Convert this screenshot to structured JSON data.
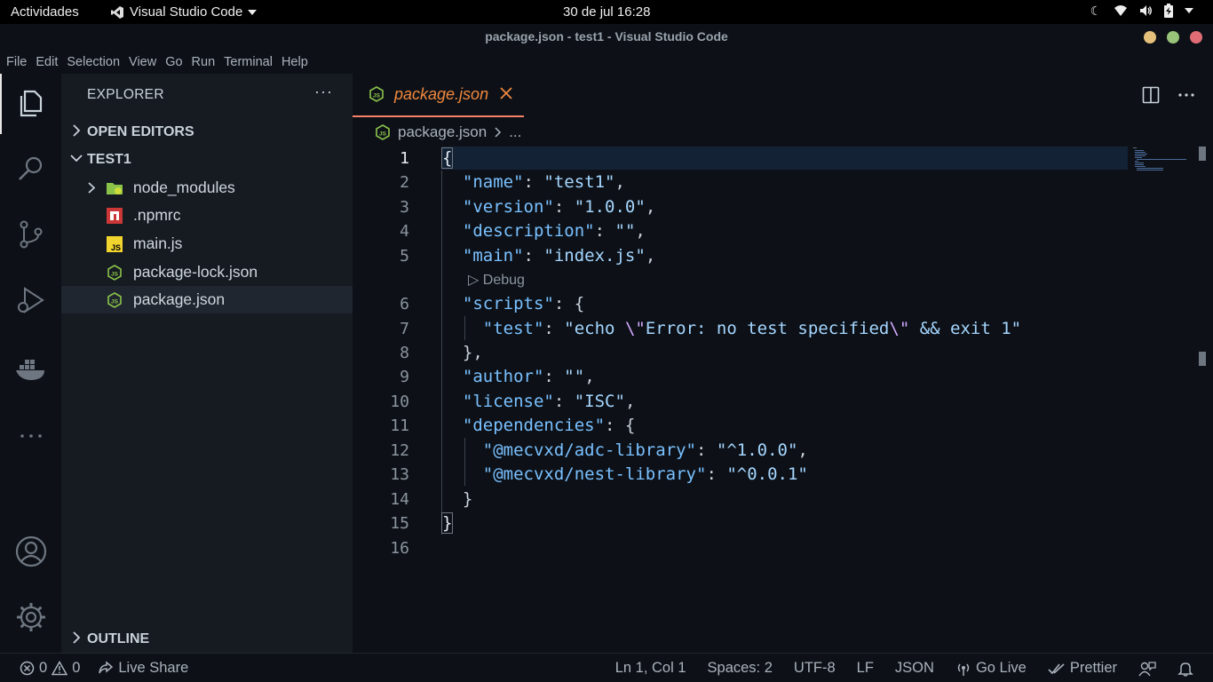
{
  "topbar": {
    "activities": "Actividades",
    "app_name": "Visual Studio Code",
    "clock": "30 de jul  16:28"
  },
  "window": {
    "title": "package.json - test1 - Visual Studio Code",
    "buttons": {
      "minimize_color": "#e5c07b",
      "maximize_color": "#98c379",
      "close_color": "#e06c75"
    }
  },
  "menu": [
    "File",
    "Edit",
    "Selection",
    "View",
    "Go",
    "Run",
    "Terminal",
    "Help"
  ],
  "activity_bar": [
    "explorer-icon",
    "search-icon",
    "source-control-icon",
    "run-debug-icon",
    "docker-icon",
    "more-icon",
    "account-icon",
    "settings-gear-icon"
  ],
  "sidebar": {
    "title": "EXPLORER",
    "more": "···",
    "open_editors": "OPEN EDITORS",
    "folder": "TEST1",
    "items": [
      {
        "label": "node_modules",
        "icon": "folder-node-icon"
      },
      {
        "label": ".npmrc",
        "icon": "npm-icon"
      },
      {
        "label": "main.js",
        "icon": "js-icon"
      },
      {
        "label": "package-lock.json",
        "icon": "nodejs-icon"
      },
      {
        "label": "package.json",
        "icon": "nodejs-icon"
      }
    ],
    "outline": "OUTLINE"
  },
  "editor": {
    "tab_label": "package.json",
    "breadcrumb_file": "package.json",
    "breadcrumb_more": "...",
    "codelens": "Debug",
    "line_numbers": [
      "1",
      "2",
      "3",
      "4",
      "5",
      "6",
      "7",
      "8",
      "9",
      "10",
      "11",
      "12",
      "13",
      "14",
      "15",
      "16"
    ]
  },
  "status": {
    "errors": "0",
    "warnings": "0",
    "live_share": "Live Share",
    "position": "Ln 1, Col 1",
    "spaces": "Spaces: 2",
    "encoding": "UTF-8",
    "eol": "LF",
    "language": "JSON",
    "go_live": "Go Live",
    "prettier": "Prettier"
  },
  "colors": {
    "accent": "#f78166",
    "tab_text": "#f0883e",
    "json_key": "#79c0ff",
    "json_string": "#a5d6ff"
  }
}
